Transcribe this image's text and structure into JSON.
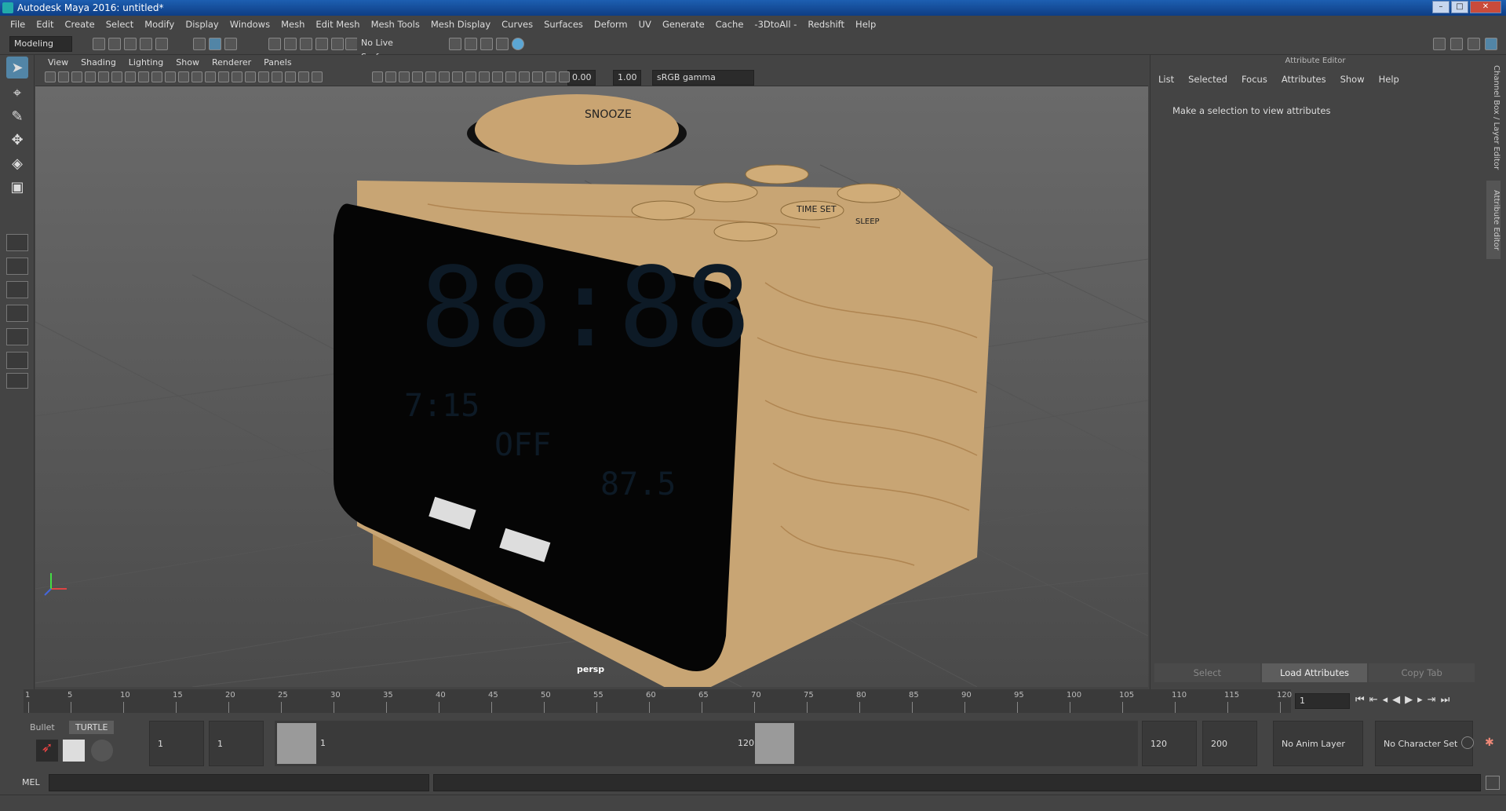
{
  "window": {
    "title": "Autodesk Maya 2016: untitled*",
    "min": "–",
    "max": "□",
    "close": "✕"
  },
  "menubar": [
    "File",
    "Edit",
    "Create",
    "Select",
    "Modify",
    "Display",
    "Windows",
    "Mesh",
    "Edit Mesh",
    "Mesh Tools",
    "Mesh Display",
    "Curves",
    "Surfaces",
    "Deform",
    "UV",
    "Generate",
    "Cache",
    "-3DtoAll -",
    "Redshift",
    "Help"
  ],
  "shelf": {
    "mode": "Modeling",
    "live_surface": "No Live Surface"
  },
  "viewport": {
    "menu": [
      "View",
      "Shading",
      "Lighting",
      "Show",
      "Renderer",
      "Panels"
    ],
    "exposure": "0.00",
    "gamma": "1.00",
    "colorspace": "sRGB gamma",
    "camera_label": "persp",
    "clock_labels": {
      "snooze": "SNOOZE",
      "time_set": "TIME SET",
      "sleep": "SLEEP",
      "display": "88:88",
      "alarm_time": "7:15",
      "alarm_state": "OFF",
      "radio": "87.5"
    }
  },
  "attribute_editor": {
    "title": "Attribute Editor",
    "menu": [
      "List",
      "Selected",
      "Focus",
      "Attributes",
      "Show",
      "Help"
    ],
    "message": "Make a selection to view attributes",
    "buttons": {
      "select": "Select",
      "load": "Load Attributes",
      "copy": "Copy Tab"
    }
  },
  "side_tabs": {
    "channel_box": "Channel Box / Layer Editor",
    "attribute_editor": "Attribute Editor"
  },
  "timeline": {
    "ticks": [
      1,
      5,
      10,
      15,
      20,
      25,
      30,
      35,
      40,
      45,
      50,
      55,
      60,
      65,
      70,
      75,
      80,
      85,
      90,
      95,
      100,
      105,
      110,
      115,
      120
    ],
    "current_frame": "1"
  },
  "range": {
    "shelf_tabs": [
      "Bullet",
      "TURTLE"
    ],
    "start": "1",
    "start_inner": "1",
    "slider_start": "1",
    "slider_end": "120",
    "end_inner": "120",
    "end": "200",
    "anim_layer": "No Anim Layer",
    "char_set": "No Character Set"
  },
  "cmdline": {
    "label": "MEL"
  }
}
